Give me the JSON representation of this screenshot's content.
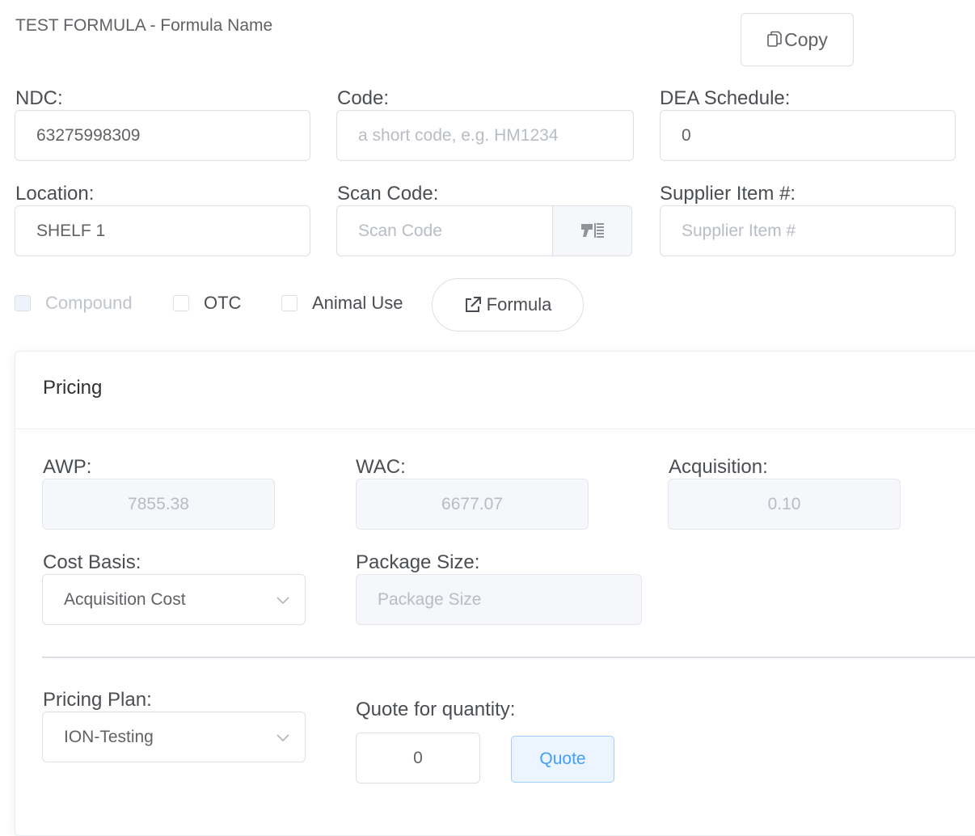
{
  "header": {
    "title": "TEST FORMULA - Formula Name",
    "copy_label": "Copy"
  },
  "fields": {
    "ndc": {
      "label": "NDC:",
      "value": "63275998309"
    },
    "code": {
      "label": "Code:",
      "placeholder": "a short code, e.g. HM1234"
    },
    "dea": {
      "label": "DEA Schedule:",
      "value": "0"
    },
    "location": {
      "label": "Location:",
      "value": "SHELF 1"
    },
    "scan_code": {
      "label": "Scan Code:",
      "placeholder": "Scan Code",
      "icon": "barcode-scanner-icon"
    },
    "supplier_item": {
      "label": "Supplier Item #:",
      "placeholder": "Supplier Item #"
    }
  },
  "checkboxes": {
    "compound": {
      "label": "Compound",
      "checked": false,
      "disabled": true
    },
    "otc": {
      "label": "OTC",
      "checked": false
    },
    "animal_use": {
      "label": "Animal Use",
      "checked": false
    }
  },
  "formula_button": {
    "label": "Formula",
    "icon": "external-link-icon"
  },
  "pricing": {
    "title": "Pricing",
    "awp": {
      "label": "AWP:",
      "value": "7855.38"
    },
    "wac": {
      "label": "WAC:",
      "value": "6677.07"
    },
    "acquisition": {
      "label": "Acquisition:",
      "value": "0.10"
    },
    "cost_basis": {
      "label": "Cost Basis:",
      "selected": "Acquisition Cost"
    },
    "package_size": {
      "label": "Package Size:",
      "placeholder": "Package Size"
    },
    "pricing_plan": {
      "label": "Pricing Plan:",
      "selected": "ION-Testing"
    },
    "quote_quantity": {
      "label": "Quote for quantity:",
      "value": "0"
    },
    "quote_label": "Quote"
  },
  "colors": {
    "accent": "#409eff",
    "border": "#dcdfe6",
    "disabled_bg": "#f5f7fa"
  }
}
